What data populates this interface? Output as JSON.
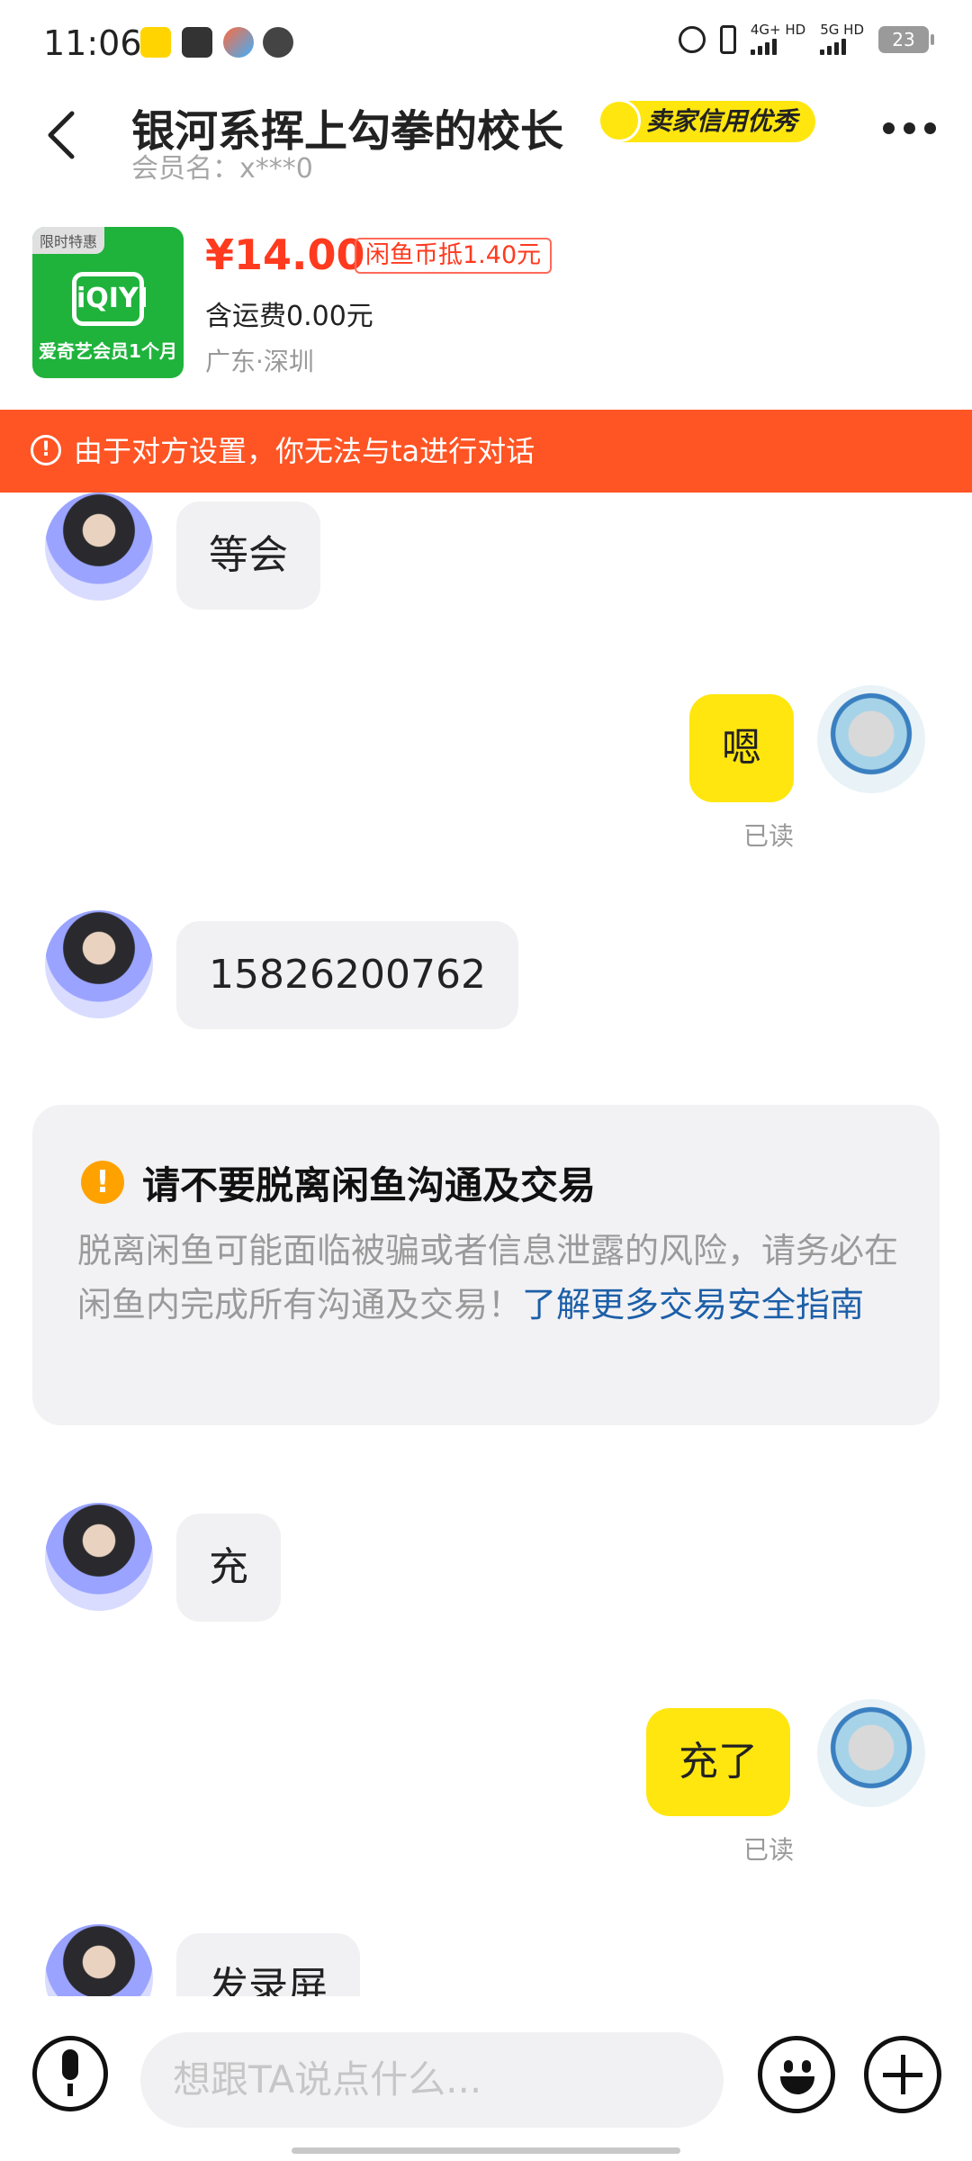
{
  "status": {
    "time": "11:06",
    "network1": "4G+ HD",
    "network2": "5G HD",
    "battery": "23"
  },
  "header": {
    "title": "银河系挥上勾拳的校长",
    "seller_badge": "卖家信用优秀",
    "member": "会员名：x***0"
  },
  "product": {
    "tag": "限时特惠",
    "thumb_name": "爱奇艺会员1个月",
    "price": "¥14.00",
    "coin": "闲鱼币抵1.40元",
    "shipping": "含运费0.00元",
    "location": "广东·深圳"
  },
  "notice": {
    "text": "由于对方设置，你无法与ta进行对话"
  },
  "messages": {
    "m1": "等会",
    "m2": "嗯",
    "m2_read": "已读",
    "m3": "15826200762",
    "m4": "充",
    "m5": "充了",
    "m5_read": "已读",
    "m6": "发录屏"
  },
  "warning": {
    "title": "请不要脱离闲鱼沟通及交易",
    "body": "脱离闲鱼可能面临被骗或者信息泄露的风险，请务必在闲鱼内完成所有沟通及交易！",
    "link": "了解更多交易安全指南"
  },
  "input": {
    "placeholder": "想跟TA说点什么..."
  },
  "colors": {
    "accent_yellow": "#ffe60f",
    "alert_orange": "#ff5424",
    "price_red": "#ff3a1f",
    "link_blue": "#1d5fa8"
  },
  "icons": [
    "back-icon",
    "more-icon",
    "alert-icon",
    "voice-icon",
    "emoji-icon",
    "plus-icon"
  ]
}
